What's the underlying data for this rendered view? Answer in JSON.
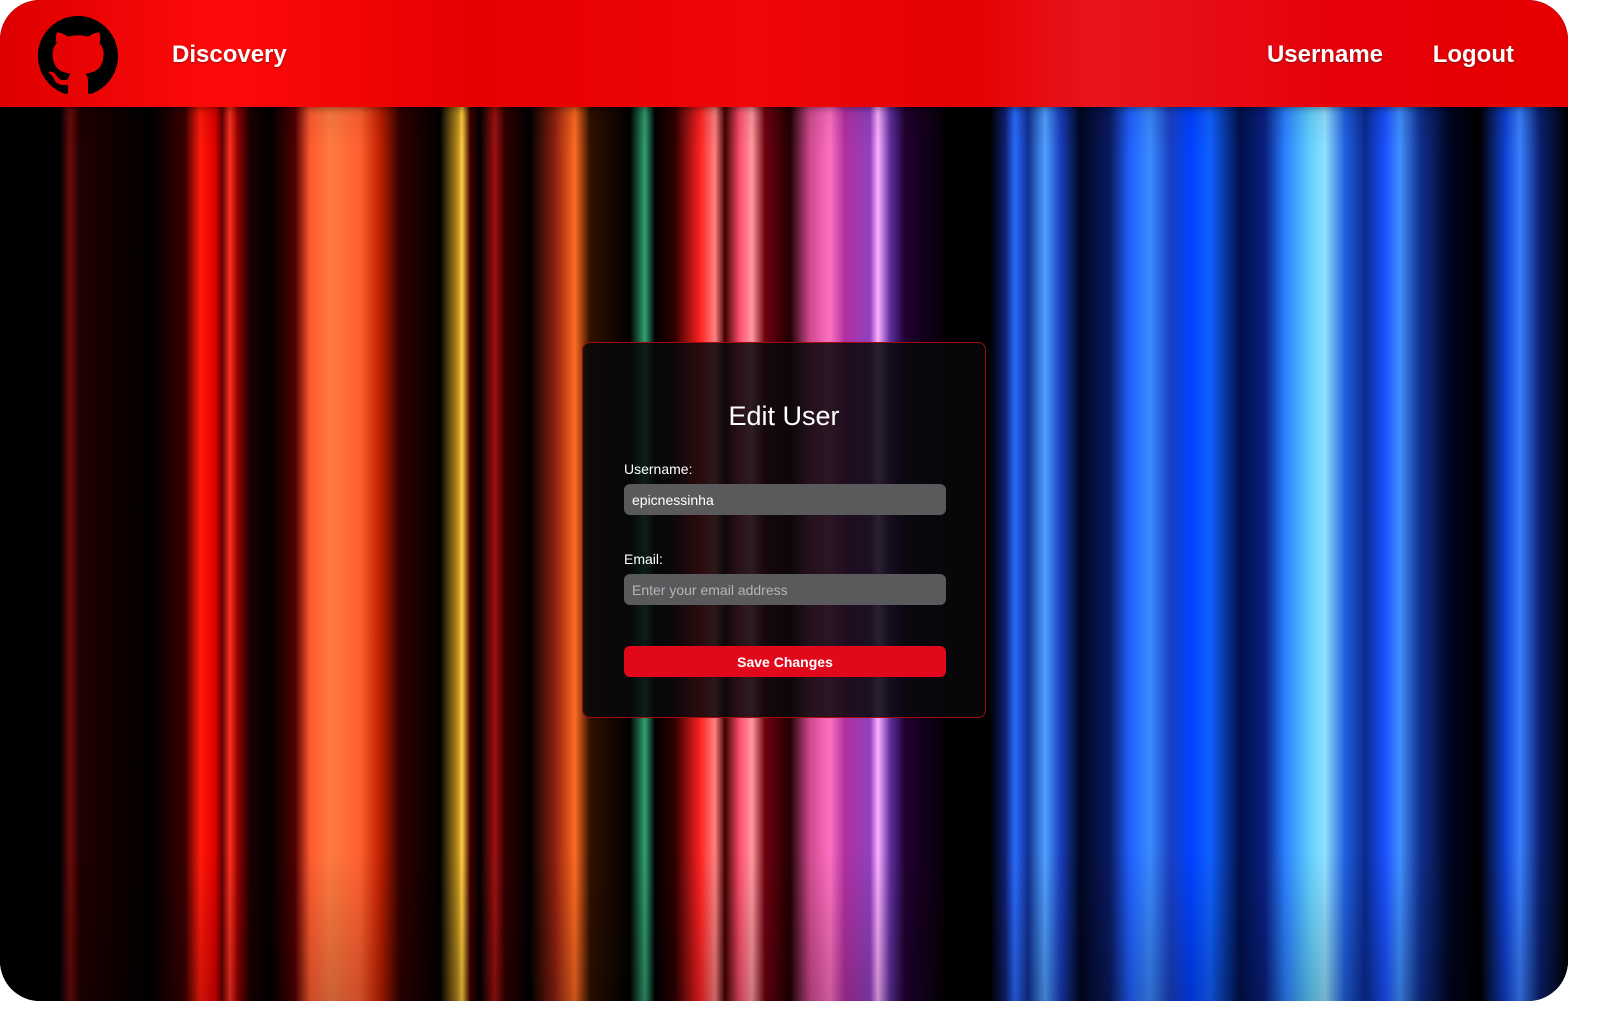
{
  "nav": {
    "logo_icon": "github-icon",
    "discovery_label": "Discovery",
    "username_label": "Username",
    "logout_label": "Logout",
    "accent_color": "#e60000"
  },
  "form": {
    "title": "Edit User",
    "username_label": "Username:",
    "username_value": "epicnessinha",
    "email_label": "Email:",
    "email_value": "",
    "email_placeholder": "Enter your email address",
    "save_label": "Save Changes",
    "button_color": "#e0081a"
  }
}
